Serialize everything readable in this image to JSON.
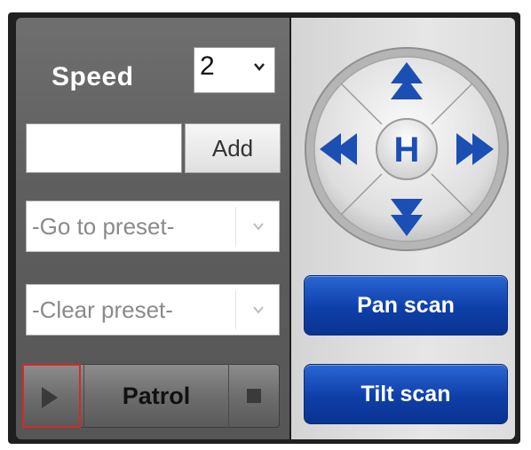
{
  "speed": {
    "label": "Speed",
    "value": "2"
  },
  "preset_input": {
    "value": ""
  },
  "add_button": {
    "label": "Add"
  },
  "goto_preset": {
    "selected": "-Go to preset-"
  },
  "clear_preset": {
    "selected": "-Clear preset-"
  },
  "patrol": {
    "label": "Patrol"
  },
  "ptz": {
    "home_label": "H"
  },
  "pan_scan": {
    "label": "Pan scan"
  },
  "tilt_scan": {
    "label": "Tilt scan"
  },
  "colors": {
    "accent_blue": "#0e3fa8",
    "highlight_red": "#d42a2a"
  }
}
